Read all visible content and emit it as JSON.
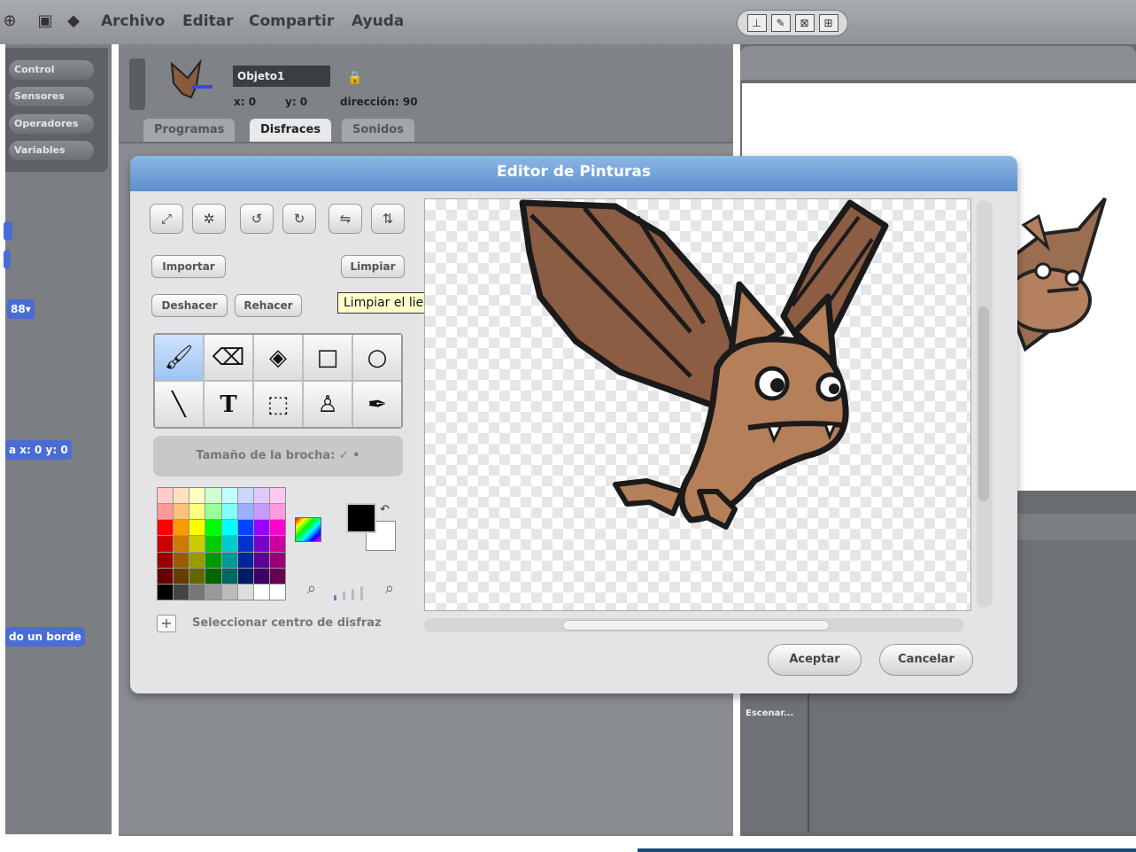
{
  "menu": {
    "archivo": "Archivo",
    "editar": "Editar",
    "compartir": "Compartir",
    "ayuda": "Ayuda"
  },
  "categories": [
    "Control",
    "Sensores",
    "Operadores",
    "Variables"
  ],
  "blocks": {
    "block_a": "88▾",
    "block_b": "a x: 0 y: 0",
    "block_c": "do un borde"
  },
  "sprite": {
    "name": "Objeto1",
    "x_label": "x: 0",
    "y_label": "y: 0",
    "direction_label": "dirección: 90"
  },
  "tabs": [
    "Programas",
    "Disfraces",
    "Sonidos"
  ],
  "stage_bottom_label": "Escenar...",
  "dialog": {
    "title": "Editor de Pinturas",
    "import_label": "Importar",
    "clear_label": "Limpiar",
    "undo_label": "Deshacer",
    "redo_label": "Rehacer",
    "tooltip": "Limpiar el lienzo",
    "brush_size_label": "Tamaño de la brocha: ✓  •",
    "set_center_label": "Seleccionar centro de disfraz",
    "accept_label": "Aceptar",
    "cancel_label": "Cancelar"
  },
  "palette_colors": [
    "#ffcccc",
    "#ffe0c0",
    "#ffffc0",
    "#d0ffd0",
    "#c0ffff",
    "#c8d8ff",
    "#e0c8ff",
    "#ffc8f0",
    "#ff9999",
    "#ffc080",
    "#ffff80",
    "#99ff99",
    "#80ffff",
    "#99b0ff",
    "#c899ff",
    "#ff99e0",
    "#ff0000",
    "#ff9900",
    "#ffff00",
    "#00ff00",
    "#00ffff",
    "#0044ff",
    "#9900ff",
    "#ff00cc",
    "#cc0000",
    "#cc7a00",
    "#cccc00",
    "#00cc00",
    "#00cccc",
    "#0033cc",
    "#7a00cc",
    "#cc00a0",
    "#990000",
    "#995c00",
    "#999900",
    "#009900",
    "#009999",
    "#002699",
    "#5c0099",
    "#990078",
    "#660000",
    "#663d00",
    "#666600",
    "#006600",
    "#006666",
    "#001a66",
    "#3d0066",
    "#660050",
    "#000000",
    "#444444",
    "#777777",
    "#999999",
    "#bbbbbb",
    "#dddddd",
    "#ffffff",
    "#ffffff"
  ]
}
